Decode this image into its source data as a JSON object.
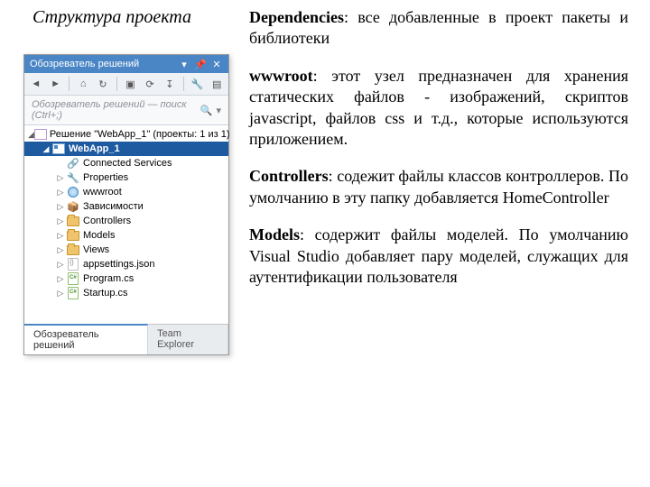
{
  "slide_title": "Структура проекта",
  "descriptions": {
    "deps_b": "Dependencies",
    "deps_t": ": все добавленные в проект пакеты и библиотеки",
    "www_b": "wwwroot",
    "www_t": ": этот узел предназначен для хранения статических файлов - изображений, скриптов javascript, файлов css и т.д., которые используются приложением.",
    "ctrl_b": "Controllers",
    "ctrl_t": ": содежит файлы классов контроллеров. По умолчанию в эту папку добавляется HomeController",
    "models_b": "Models",
    "models_t": ": содержит файлы моделей. По умолчанию Visual Studio добавляет пару моделей, служащих для аутентификации пользователя"
  },
  "panel": {
    "title": "Обозреватель решений",
    "search_placeholder": "Обозреватель решений — поиск (Ctrl+;)",
    "tabs": {
      "solution_explorer": "Обозреватель решений",
      "team_explorer": "Team Explorer"
    }
  },
  "tree": {
    "solution": "Решение \"WebApp_1\" (проекты: 1 из 1)",
    "project": "WebApp_1",
    "nodes": {
      "connected": "Connected Services",
      "properties": "Properties",
      "wwwroot": "wwwroot",
      "deps": "Зависимости",
      "controllers": "Controllers",
      "models": "Models",
      "views": "Views",
      "appsettings": "appsettings.json",
      "program": "Program.cs",
      "startup": "Startup.cs"
    }
  }
}
